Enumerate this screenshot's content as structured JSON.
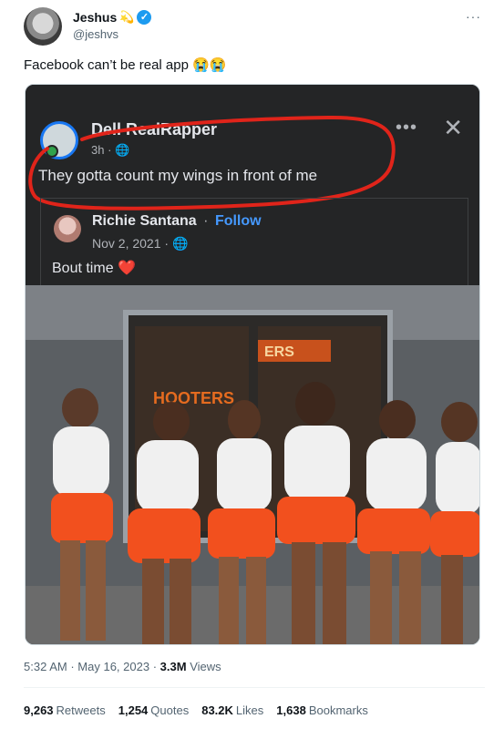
{
  "author": {
    "display_name": "Jeshus",
    "name_emoji": "💫",
    "handle": "@jeshvs",
    "verified": true
  },
  "tweet": {
    "text": "Facebook can’t be real app 😭😭",
    "more_icon": "more-horizontal-icon"
  },
  "embed": {
    "poster_name": "Dell RealRapper",
    "poster_time": "3h · 🌐",
    "post_text": "They gotta count my wings in front of me",
    "annotation_color": "#e0241a",
    "shared": {
      "name": "Richie Santana",
      "separator": "·",
      "follow_label": "Follow",
      "date": "Nov 2, 2021 · 🌐",
      "text": "Bout time",
      "heart": "❤️"
    },
    "photo_signs": [
      "ERS",
      "HOOTERS"
    ]
  },
  "meta": {
    "time": "5:32 AM",
    "date": "May 16, 2023",
    "views_count": "3.3M",
    "views_label": "Views",
    "sep": "·"
  },
  "stats": {
    "retweets": "9,263",
    "retweets_label": "Retweets",
    "quotes": "1,254",
    "quotes_label": "Quotes",
    "likes": "83.2K",
    "likes_label": "Likes",
    "bookmarks": "1,638",
    "bookmarks_label": "Bookmarks"
  },
  "colors": {
    "link_blue": "#1d9bf0",
    "fb_dark": "#242526",
    "fb_follow": "#4599ff"
  }
}
